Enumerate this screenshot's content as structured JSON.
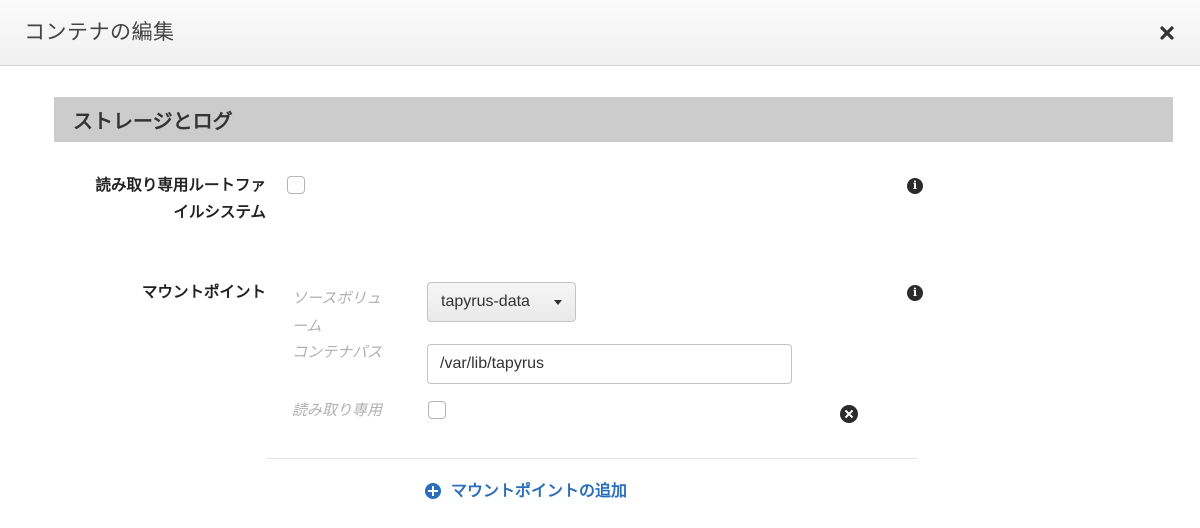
{
  "modal": {
    "title": "コンテナの編集",
    "close_icon": "close-icon"
  },
  "section": {
    "title": "ストレージとログ"
  },
  "readonly_root": {
    "label_line1": "読み取り専用ルートファ",
    "label_line2": "イルシステム",
    "checked": false,
    "info_icon": "info-icon"
  },
  "mount_points": {
    "label": "マウントポイント",
    "info_icon": "info-icon",
    "items": [
      {
        "source_volume_label": "ソースボリューム",
        "source_volume_value": "tapyrus-data",
        "container_path_label": "コンテナパス",
        "container_path_value": "/var/lib/tapyrus",
        "read_only_label": "読み取り専用",
        "read_only_checked": false,
        "remove_icon": "remove-icon"
      }
    ],
    "add_label": "マウントポイントの追加",
    "add_icon": "plus-circle-icon"
  },
  "colors": {
    "link": "#2a6ebb",
    "section_bg": "#cccccc",
    "muted_label": "#b0b0b0"
  }
}
